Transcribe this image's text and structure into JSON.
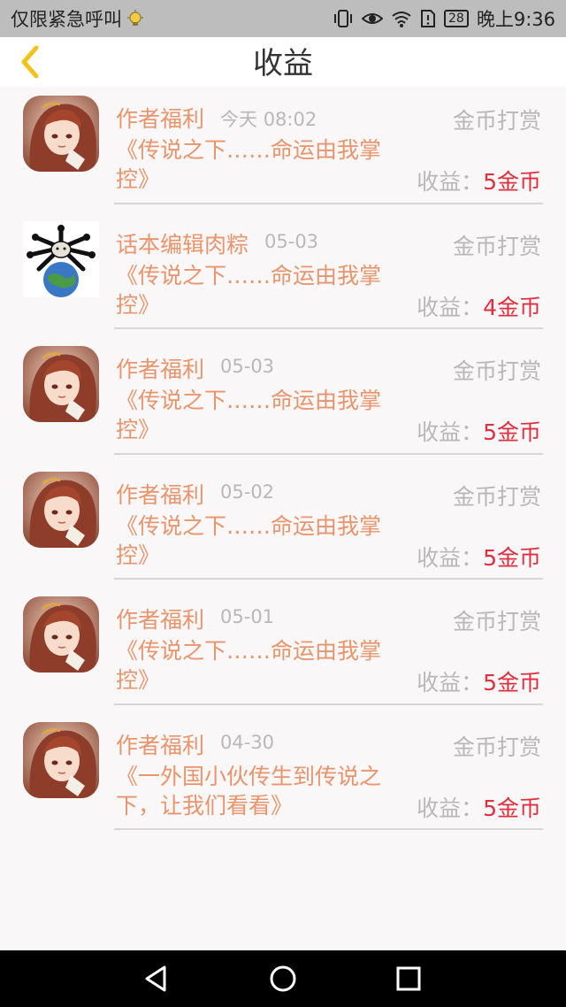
{
  "status_bar": {
    "carrier_text": "仅限紧急呼叫",
    "battery": "28",
    "time": "晚上9:36"
  },
  "header": {
    "title": "收益",
    "back_icon": "chevron-left-icon",
    "accent_color": "#f2c21b"
  },
  "earnings": [
    {
      "name": "作者福利",
      "date": "今天 08:02",
      "type": "金币打赏",
      "work": "《传说之下……命运由我掌控》",
      "earn_label": "收益：",
      "amount": "5金币",
      "avatar": "anime-girl"
    },
    {
      "name": "话本编辑肉粽",
      "date": "05-03",
      "type": "金币打赏",
      "work": "《传说之下……命运由我掌控》",
      "earn_label": "收益：",
      "amount": "4金币",
      "avatar": "globe-mascot"
    },
    {
      "name": "作者福利",
      "date": "05-03",
      "type": "金币打赏",
      "work": "《传说之下……命运由我掌控》",
      "earn_label": "收益：",
      "amount": "5金币",
      "avatar": "anime-girl"
    },
    {
      "name": "作者福利",
      "date": "05-02",
      "type": "金币打赏",
      "work": "《传说之下……命运由我掌控》",
      "earn_label": "收益：",
      "amount": "5金币",
      "avatar": "anime-girl"
    },
    {
      "name": "作者福利",
      "date": "05-01",
      "type": "金币打赏",
      "work": "《传说之下……命运由我掌控》",
      "earn_label": "收益：",
      "amount": "5金币",
      "avatar": "anime-girl"
    },
    {
      "name": "作者福利",
      "date": "04-30",
      "type": "金币打赏",
      "work": "《一外国小伙传生到传说之下，让我们看看》",
      "earn_label": "收益：",
      "amount": "5金币",
      "avatar": "anime-girl"
    }
  ],
  "colors": {
    "name_color": "#e9946b",
    "muted_color": "#b8b8b8",
    "amount_color": "#e02f3f"
  }
}
